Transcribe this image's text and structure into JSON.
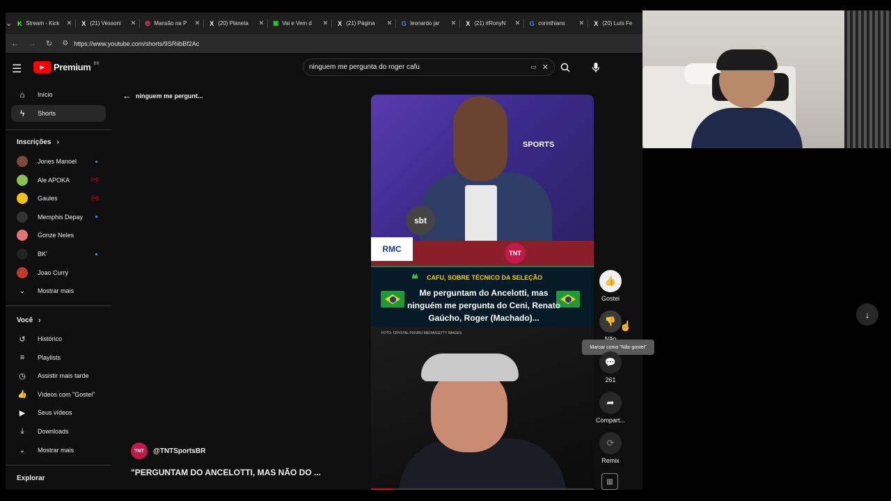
{
  "browser": {
    "tabs": [
      {
        "label": "Stream - Kick",
        "icon": "kick-icon",
        "icon_char": "K",
        "color": "#53fc18"
      },
      {
        "label": "(21) Vessoni",
        "icon": "x-icon",
        "icon_char": "X",
        "color": "#ffffff"
      },
      {
        "label": "Mansão na P",
        "icon": "app-icon",
        "icon_char": "◎",
        "color": "#ff4d6d"
      },
      {
        "label": "(20) Planeta",
        "icon": "x-icon",
        "icon_char": "X",
        "color": "#ffffff"
      },
      {
        "label": "Vai e Vem d",
        "icon": "sheet-icon",
        "icon_char": "▣",
        "color": "#2ecc40"
      },
      {
        "label": "(21) Página",
        "icon": "x-icon",
        "icon_char": "X",
        "color": "#ffffff"
      },
      {
        "label": "leonardo jar",
        "icon": "google-icon",
        "icon_char": "G",
        "color": "#4285f4"
      },
      {
        "label": "(21) #RonyN",
        "icon": "x-icon",
        "icon_char": "X",
        "color": "#ffffff"
      },
      {
        "label": "corinthians",
        "icon": "google-icon",
        "icon_char": "G",
        "color": "#4285f4"
      },
      {
        "label": "(20) Luís Fe",
        "icon": "x-icon",
        "icon_char": "X",
        "color": "#ffffff"
      }
    ],
    "url": "https://www.youtube.com/shorts/9SRiibBf2Ac"
  },
  "youtube": {
    "logo_text": "Premium",
    "logo_region": "BR",
    "search_query": "ninguem me pergunta do roger cafu",
    "back_label": "ninguem me pergunt...",
    "sidebar": {
      "main": [
        {
          "label": "Início",
          "icon": "home-icon"
        },
        {
          "label": "Shorts",
          "icon": "shorts-icon"
        }
      ],
      "subscriptions_title": "Inscrições",
      "subscriptions": [
        {
          "label": "Jones Manoel",
          "color": "#7a4a3a",
          "status": "dot"
        },
        {
          "label": "Ale APOKA",
          "color": "#8bc34a",
          "status": "live"
        },
        {
          "label": "Gaules",
          "color": "#f4c20d",
          "status": "live"
        },
        {
          "label": "Memphis Depay",
          "color": "#333333",
          "status": "dot"
        },
        {
          "label": "Gonze Neles",
          "color": "#e57373",
          "status": "none"
        },
        {
          "label": "BK'",
          "color": "#222222",
          "status": "dot"
        },
        {
          "label": "Joao Curry",
          "color": "#c0392b",
          "status": "none"
        }
      ],
      "show_more": "Mostrar mais",
      "you_title": "Você",
      "you": [
        {
          "label": "Histórico",
          "icon": "history-icon"
        },
        {
          "label": "Playlists",
          "icon": "playlist-icon"
        },
        {
          "label": "Assistir mais tarde",
          "icon": "clock-icon"
        },
        {
          "label": "Vídeos com \"Gostei\"",
          "icon": "like-icon"
        },
        {
          "label": "Seus vídeos",
          "icon": "video-icon"
        },
        {
          "label": "Downloads",
          "icon": "download-icon"
        }
      ],
      "show_more_2": "Mostrar mais",
      "explore_title": "Explorar"
    },
    "short": {
      "watermark": "SPORTS",
      "sbt": "sbt",
      "rmc": "RMC",
      "tnt": "TNT",
      "band_subtitle": "CAFU, SOBRE TÉCNICO DA SELEÇÃO",
      "band_quote": "Me perguntam do Ancelotti, mas ninguém me pergunta do Ceni, Renato Gaúcho, Roger (Machado)...",
      "photo_credit": "FOTO: CRYSTAL PIXURU MEDIA/GETTY IMAGES",
      "progress": 0.1,
      "channel_avatar": "TNT",
      "channel": "@TNTSportsBR",
      "title": "\"PERGUNTAM DO ANCELOTTI, MAS NÃO DO ..."
    },
    "actions": {
      "like": "Gostei",
      "dislike": "Não",
      "comments": "261",
      "share": "Compart...",
      "remix": "Remix",
      "tooltip": "Marcar como \"Não gostei\""
    }
  },
  "colors": {
    "accent": "#ff0000",
    "band_green": "#3cc24a",
    "band_yellow": "#f5d000"
  }
}
